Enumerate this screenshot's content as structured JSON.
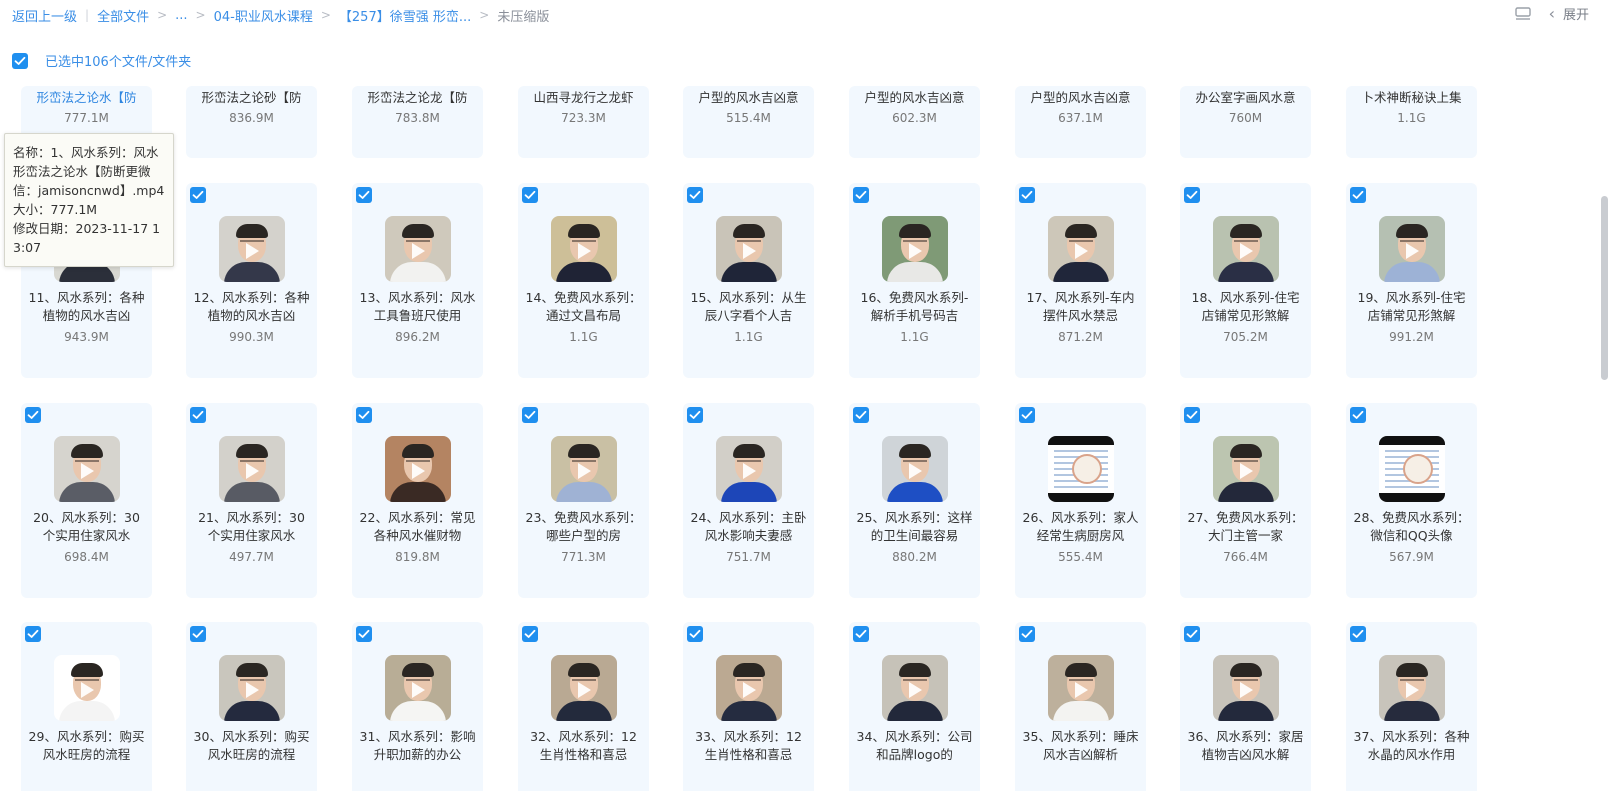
{
  "breadcrumb": {
    "back": "返回上一级",
    "all_files": "全部文件",
    "ellipsis": "...",
    "folder1": "04-职业风水课程",
    "folder2": "【257】徐雪强 形峦...",
    "current": "未压缩版"
  },
  "top_right": {
    "list_view_icon": "list-view-icon",
    "collapse_label": "展开"
  },
  "selection": {
    "text": "已选中106个文件/文件夹",
    "checked": true
  },
  "tooltip": {
    "name_line": "名称：1、风水系列：风水形峦法之论水【防断更微信：jamisoncnwd】.mp4",
    "size_line": "大小：777.1M",
    "date_line": "修改日期：2023-11-17 13:07"
  },
  "top_row": [
    {
      "name": "形峦法之论水【防",
      "size": "777.1M",
      "highlight": true
    },
    {
      "name": "形峦法之论砂【防",
      "size": "836.9M"
    },
    {
      "name": "形峦法之论龙【防",
      "size": "783.8M"
    },
    {
      "name": "山西寻龙行之龙虾",
      "size": "723.3M"
    },
    {
      "name": "户型的风水吉凶意",
      "size": "515.4M"
    },
    {
      "name": "户型的风水吉凶意",
      "size": "602.3M"
    },
    {
      "name": "户型的风水吉凶意",
      "size": "637.1M"
    },
    {
      "name": "办公室字画风水意",
      "size": "760M"
    },
    {
      "name": "卜术神断秘诀上集",
      "size": "1.1G"
    }
  ],
  "rows": [
    [
      {
        "name": "11、风水系列：各种植物的风水吉凶",
        "size": "943.9M",
        "thumb": "video",
        "bg": "#d8d8d2",
        "body": "#2b2f3a"
      },
      {
        "name": "12、风水系列：各种植物的风水吉凶",
        "size": "990.3M",
        "thumb": "video",
        "bg": "#d4d2cc",
        "body": "#34384a"
      },
      {
        "name": "13、风水系列：风水工具鲁班尺使用",
        "size": "896.2M",
        "thumb": "video",
        "bg": "#cfc9bc",
        "body": "#f2f2f0"
      },
      {
        "name": "14、免费风水系列：通过文昌布局",
        "size": "1.1G",
        "thumb": "video",
        "bg": "#cdbf98",
        "body": "#1f2335"
      },
      {
        "name": "15、风水系列：从生辰八字看个人吉",
        "size": "1.1G",
        "thumb": "video",
        "bg": "#c9c4b8",
        "body": "#1f2538"
      },
      {
        "name": "16、免费风水系列-解析手机号码吉",
        "size": "1.1G",
        "thumb": "video",
        "bg": "#7f9a76",
        "body": "#e8e8e6"
      },
      {
        "name": "17、风水系列-车内摆件风水禁忌",
        "size": "871.2M",
        "thumb": "video",
        "bg": "#cdc7b9",
        "body": "#20263a"
      },
      {
        "name": "18、风水系列-住宅店铺常见形煞解",
        "size": "705.2M",
        "thumb": "video",
        "bg": "#b9c2b0",
        "body": "#2a2f45"
      },
      {
        "name": "19、风水系列-住宅店铺常见形煞解",
        "size": "991.2M",
        "thumb": "video",
        "bg": "#b5c0b2",
        "body": "#9db2d6"
      }
    ],
    [
      {
        "name": "20、风水系列：30个实用住家风水",
        "size": "698.4M",
        "thumb": "video",
        "bg": "#d6d4ce",
        "body": "#5a5d66"
      },
      {
        "name": "21、风水系列：30个实用住家风水",
        "size": "497.7M",
        "thumb": "video",
        "bg": "#d3d1cb",
        "body": "#585b64"
      },
      {
        "name": "22、风水系列：常见各种风水催财物",
        "size": "819.8M",
        "thumb": "video",
        "bg": "#b48462",
        "body": "#3a2a24"
      },
      {
        "name": "23、免费风水系列：哪些户型的房",
        "size": "771.3M",
        "thumb": "video",
        "bg": "#c9c0a4",
        "body": "#9fb2d4"
      },
      {
        "name": "24、风水系列：主卧风水影响夫妻感",
        "size": "751.7M",
        "thumb": "video",
        "bg": "#d2cfc8",
        "body": "#1d46b8"
      },
      {
        "name": "25、风水系列：这样的卫生间最容易",
        "size": "880.2M",
        "thumb": "video",
        "bg": "#cfd4d8",
        "body": "#1e4fc4"
      },
      {
        "name": "26、风水系列：家人经常生病厨房风",
        "size": "555.4M",
        "thumb": "doc"
      },
      {
        "name": "27、免费风水系列：大门主管一家",
        "size": "766.4M",
        "thumb": "video",
        "bg": "#bcc5b0",
        "body": "#23283a"
      },
      {
        "name": "28、免费风水系列：微信和QQ头像",
        "size": "567.9M",
        "thumb": "doc"
      }
    ],
    [
      {
        "name": "29、风水系列：购买风水旺房的流程",
        "size": "",
        "thumb": "video",
        "bg": "#ffffff",
        "body": "#f4f4f4"
      },
      {
        "name": "30、风水系列：购买风水旺房的流程",
        "size": "",
        "thumb": "video",
        "bg": "#c9c6bd",
        "body": "#242a3e"
      },
      {
        "name": "31、风水系列：影响升职加薪的办公",
        "size": "",
        "thumb": "video",
        "bg": "#b8ad96",
        "body": "#f5f5f3"
      },
      {
        "name": "32、风水系列：12生肖性格和喜忌",
        "size": "",
        "thumb": "video",
        "bg": "#b9a993",
        "body": "#232a3c"
      },
      {
        "name": "33、风水系列：12生肖性格和喜忌",
        "size": "",
        "thumb": "video",
        "bg": "#bba992",
        "body": "#252c40"
      },
      {
        "name": "34、风水系列：公司和品牌logo的",
        "size": "",
        "thumb": "video",
        "bg": "#c6c2b8",
        "body": "#22283a"
      },
      {
        "name": "35、风水系列：睡床风水吉凶解析",
        "size": "",
        "thumb": "video",
        "bg": "#bdb09c",
        "body": "#f3f3f1"
      },
      {
        "name": "36、风水系列：家居植物吉凶风水解",
        "size": "",
        "thumb": "video",
        "bg": "#c7c3ba",
        "body": "#23293c"
      },
      {
        "name": "37、风水系列：各种水晶的风水作用",
        "size": "",
        "thumb": "video",
        "bg": "#c8c4bb",
        "body": "#262b3d"
      }
    ]
  ],
  "colors": {
    "accent": "#1f8fef",
    "card_bg": "#f2f8fe",
    "link": "#3a8ee6"
  }
}
